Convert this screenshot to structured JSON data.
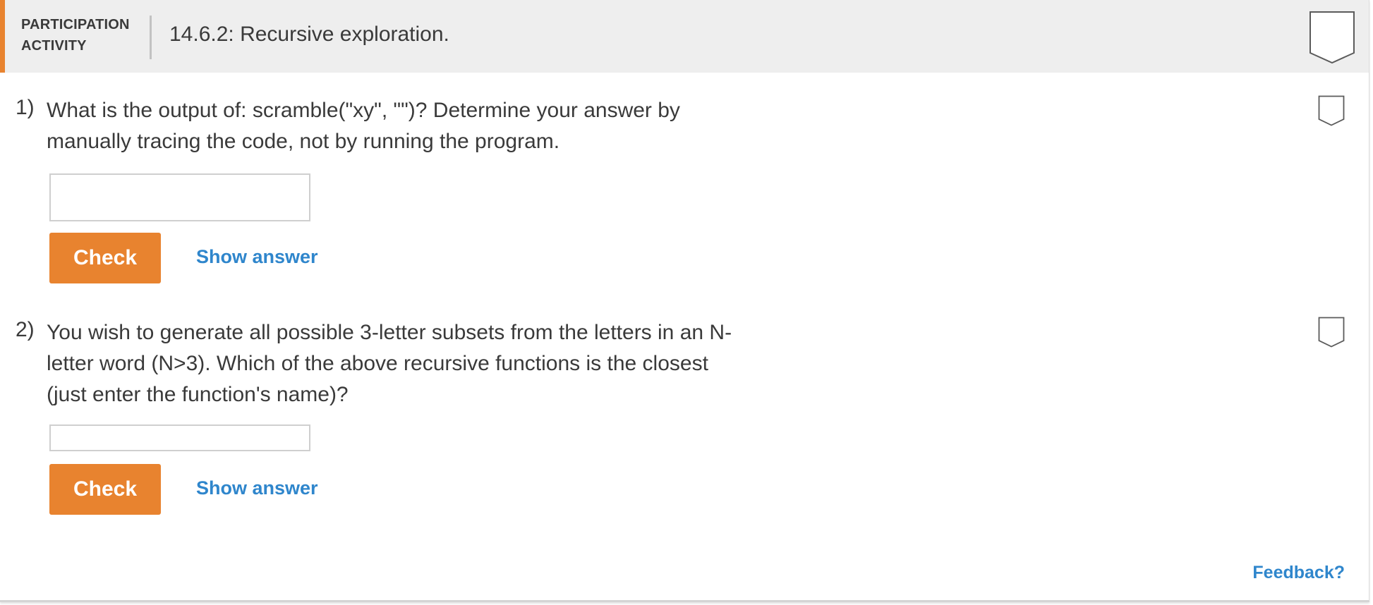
{
  "header": {
    "participation_line1": "PARTICIPATION",
    "participation_line2": "ACTIVITY",
    "title": "14.6.2: Recursive exploration."
  },
  "questions": [
    {
      "number": "1)",
      "text": "What is the output of: scramble(\"xy\", \"\")? Determine your answer by manually tracing the code, not by running the program.",
      "input_value": "",
      "check_label": "Check",
      "show_answer_label": "Show answer"
    },
    {
      "number": "2)",
      "text": "You wish to generate all possible 3-letter subsets from the letters in an N-letter word (N>3). Which of the above recursive functions is the closest (just enter the function's name)?",
      "input_value": "",
      "check_label": "Check",
      "show_answer_label": "Show answer"
    }
  ],
  "footer": {
    "feedback_label": "Feedback?"
  },
  "icons": {
    "activity_badge": "shield-badge-icon",
    "question_badge": "shield-badge-icon"
  },
  "colors": {
    "accent_orange": "#e8832f",
    "link_blue": "#2f86cc",
    "header_bg": "#eeeeee",
    "text": "#3a3a3a"
  }
}
